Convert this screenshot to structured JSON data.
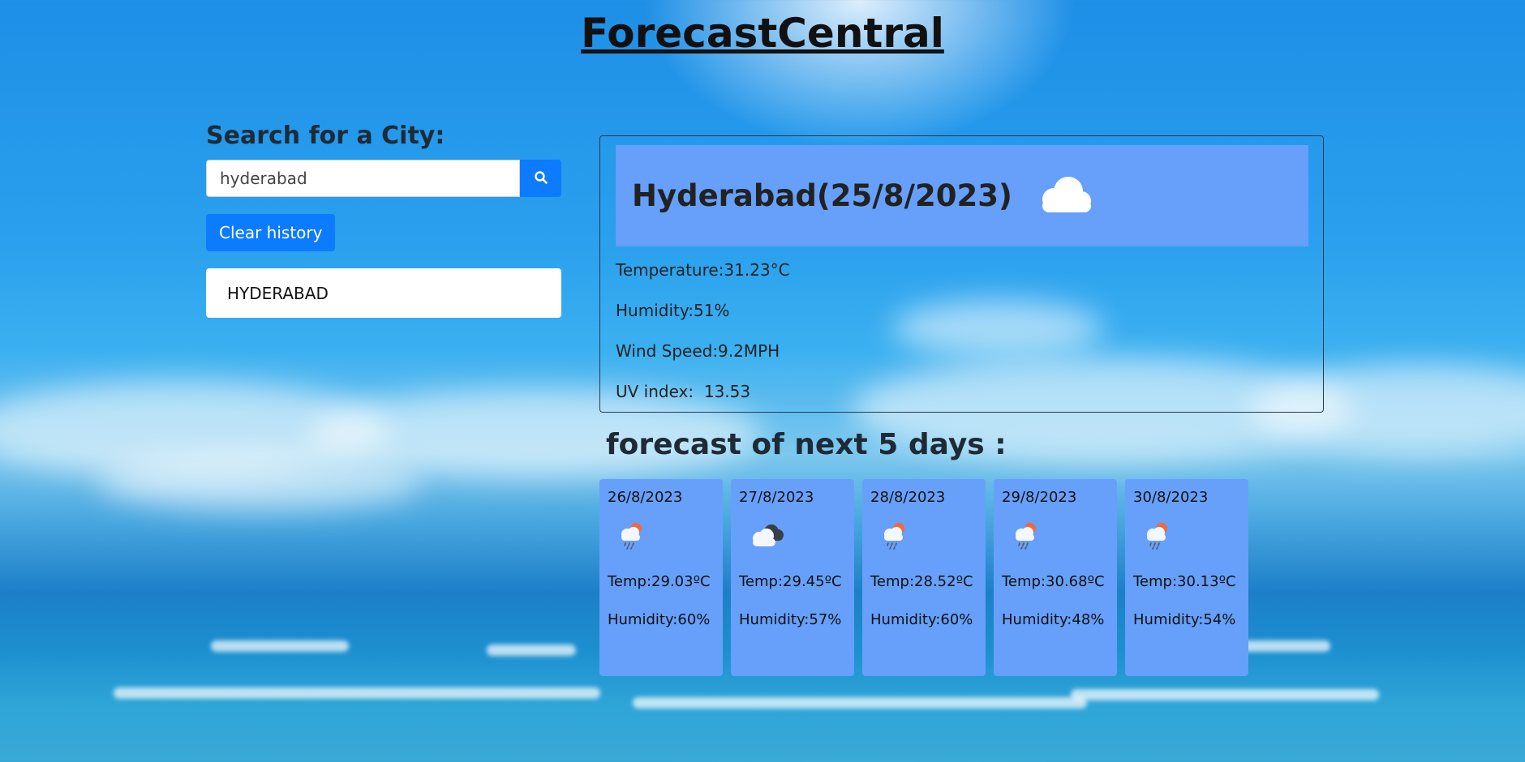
{
  "app": {
    "title": "ForecastCentral"
  },
  "search": {
    "heading": "Search for a City:",
    "value": "hyderabad",
    "placeholder": "",
    "button_icon": "search-icon",
    "clear_label": "Clear history"
  },
  "history": {
    "items": [
      "HYDERABAD"
    ]
  },
  "current": {
    "title": "Hyderabad(25/8/2023)",
    "icon": "cloud-icon",
    "temperature": "Temperature:31.23°C",
    "humidity": "Humidity:51%",
    "wind": "Wind Speed:9.2MPH",
    "uv": "UV index:  13.53"
  },
  "forecast": {
    "heading": "forecast of next 5 days :",
    "days": [
      {
        "date": "26/8/2023",
        "icon": "rain-sun-icon",
        "temp": "Temp:29.03ºC",
        "humidity": "Humidity:60%"
      },
      {
        "date": "27/8/2023",
        "icon": "dark-cloud-icon",
        "temp": "Temp:29.45ºC",
        "humidity": "Humidity:57%"
      },
      {
        "date": "28/8/2023",
        "icon": "rain-sun-icon",
        "temp": "Temp:28.52ºC",
        "humidity": "Humidity:60%"
      },
      {
        "date": "29/8/2023",
        "icon": "rain-sun-icon",
        "temp": "Temp:30.68ºC",
        "humidity": "Humidity:48%"
      },
      {
        "date": "30/8/2023",
        "icon": "rain-sun-icon",
        "temp": "Temp:30.13ºC",
        "humidity": "Humidity:54%"
      }
    ]
  },
  "colors": {
    "accent": "#0d7bfd",
    "card": "#66a0fa"
  }
}
